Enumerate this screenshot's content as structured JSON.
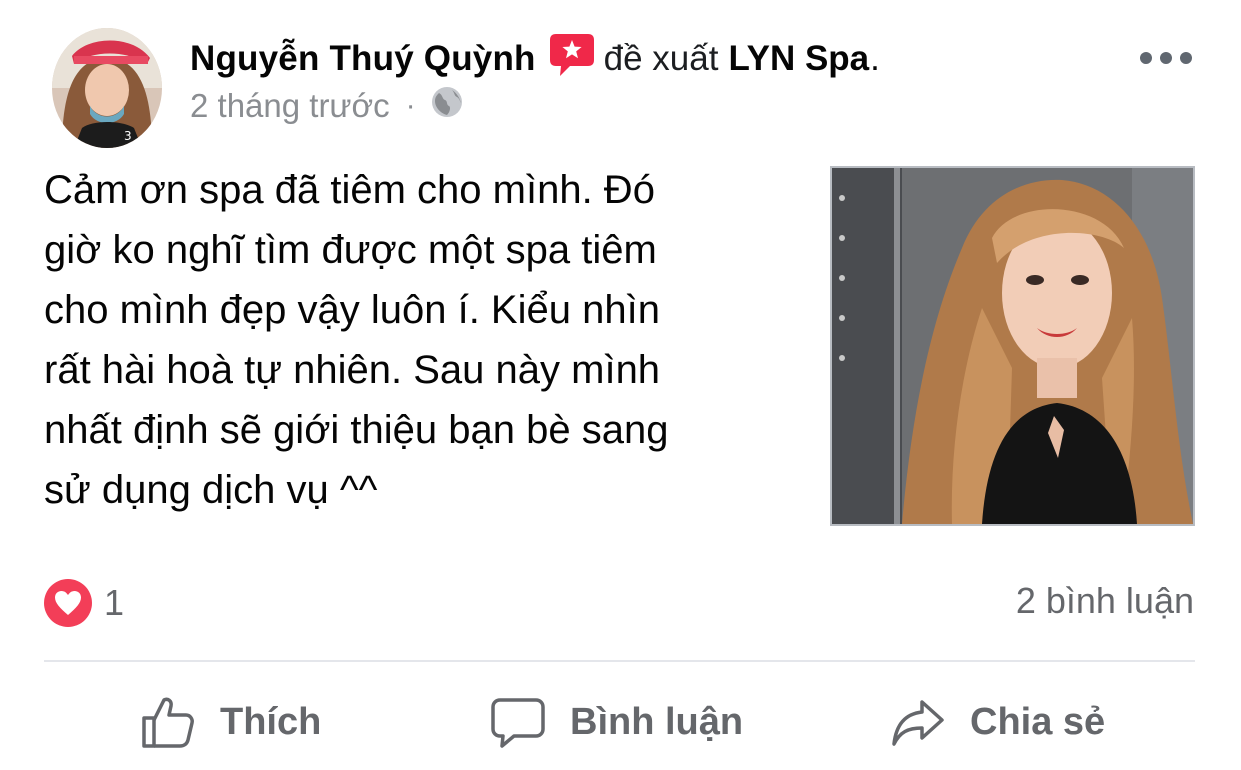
{
  "post": {
    "author_name": "Nguyễn Thuý Quỳnh",
    "recommend_verb": "đề xuất",
    "page_name": "LYN Spa",
    "period": ".",
    "timestamp": "2 tháng trước",
    "separator": "·",
    "privacy_icon": "globe-icon",
    "more_icon": "more-options-icon",
    "body_lines": [
      "Cảm ơn spa đã tiêm cho mình. Đó",
      "giờ ko nghĩ tìm được một spa tiêm",
      "cho mình đẹp vậy luôn í. Kiểu nhìn",
      "rất hài hoà tự nhiên. Sau này mình",
      "nhất định sẽ giới thiệu bạn bè sang",
      "sử dụng dịch vụ ^^"
    ]
  },
  "stats": {
    "reaction_icon": "love-reaction-icon",
    "reaction_count": "1",
    "comments_text": "2 bình luận"
  },
  "actions": {
    "like_label": "Thích",
    "comment_label": "Bình luận",
    "share_label": "Chia sẻ"
  },
  "colors": {
    "recommend_badge": "#f02849",
    "love_reaction": "#f33e58",
    "secondary_text": "#65676b",
    "divider": "#e4e6eb"
  }
}
